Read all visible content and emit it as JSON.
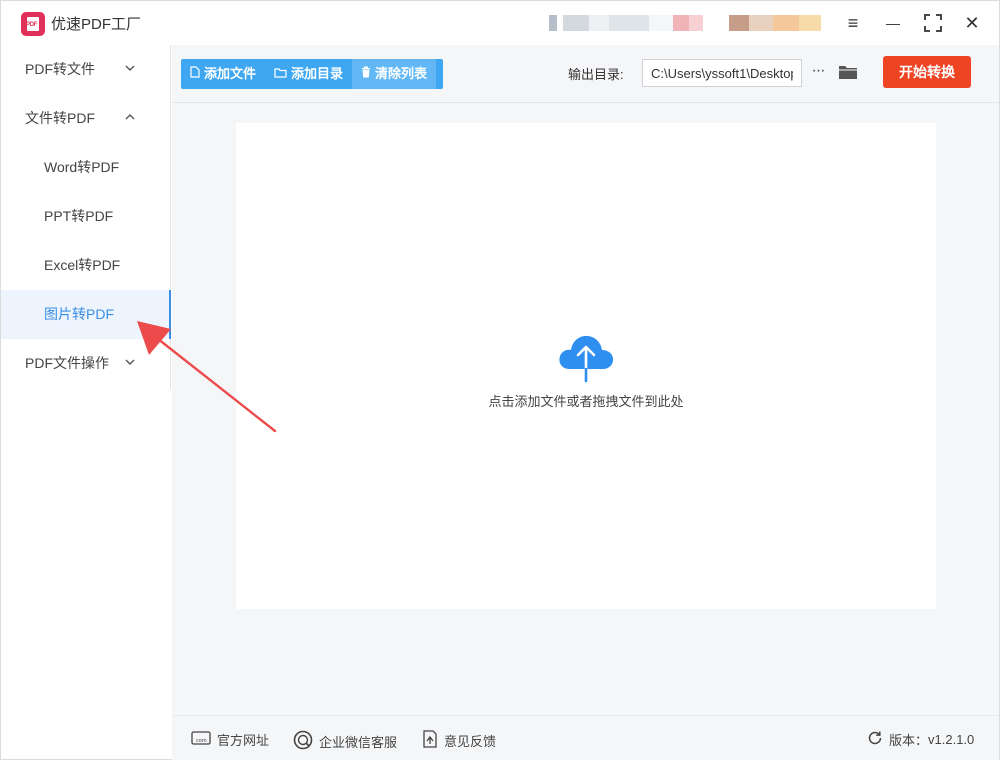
{
  "app": {
    "title": "优速PDF工厂",
    "logo_text": "PDF"
  },
  "window_controls": {
    "menu": "≡",
    "minimize": "—",
    "maximize": "⛶",
    "close": "✕"
  },
  "sidebar": {
    "items": [
      {
        "label": "PDF转文件",
        "chevron": "⌄"
      },
      {
        "label": "文件转PDF",
        "chevron": "⌃"
      },
      {
        "label": "Word转PDF"
      },
      {
        "label": "PPT转PDF"
      },
      {
        "label": "Excel转PDF"
      },
      {
        "label": "图片转PDF"
      },
      {
        "label": "PDF文件操作",
        "chevron": "⌄"
      }
    ],
    "active_item": "图片转PDF"
  },
  "toolbar": {
    "add_file": "添加文件",
    "add_folder": "添加目录",
    "clear_list": "清除列表",
    "output_label": "输出目录:",
    "output_path": "C:\\Users\\yssoft1\\Desktop",
    "more": "···",
    "start": "开始转换"
  },
  "dropzone": {
    "hint": "点击添加文件或者拖拽文件到此处"
  },
  "statusbar": {
    "site": "官方网址",
    "wechat": "企业微信客服",
    "feedback": "意见反馈",
    "version_label": "版本：",
    "version": "v1.2.1.0"
  },
  "colors": {
    "accent": "#3a8ee6",
    "toolbar_button": "#3fa7f2",
    "start_button": "#ee4424",
    "annotation_arrow": "#ec4b4b"
  },
  "icons": [
    "file-icon",
    "folder-icon",
    "trash-icon",
    "open-folder-icon",
    "cloud-upload-icon",
    "website-icon",
    "wechat-icon",
    "feedback-icon",
    "refresh-icon"
  ]
}
